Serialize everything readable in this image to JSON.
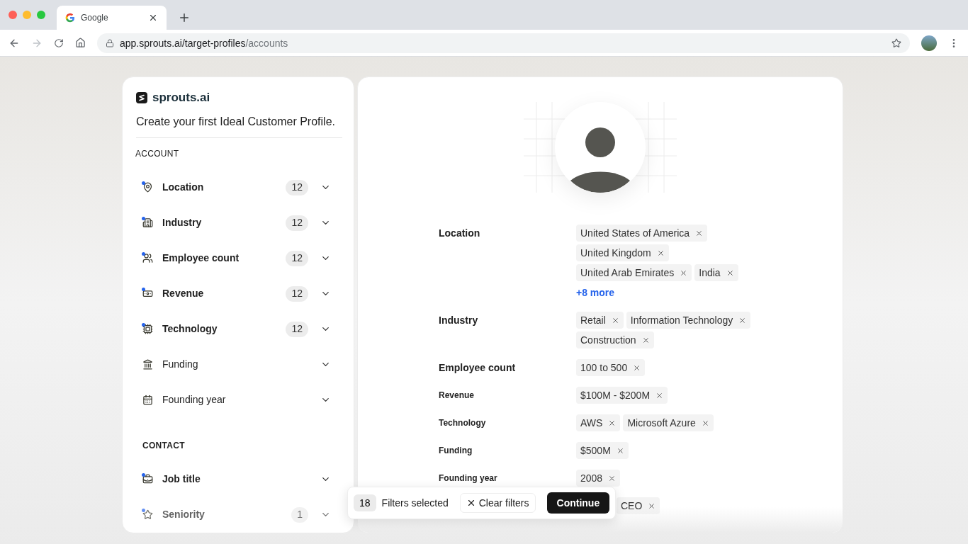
{
  "browser": {
    "tab_title": "Google",
    "url_host": "app.sprouts.ai/target-profiles",
    "url_path": "/accounts"
  },
  "sidebar": {
    "brand": "sprouts.ai",
    "heading": "Create your first Ideal Customer Profile.",
    "sections": [
      {
        "title": "ACCOUNT",
        "items": [
          {
            "label": "Location",
            "count": "12",
            "active": true
          },
          {
            "label": "Industry",
            "count": "12",
            "active": true
          },
          {
            "label": "Employee count",
            "count": "12",
            "active": true
          },
          {
            "label": "Revenue",
            "count": "12",
            "active": true
          },
          {
            "label": "Technology",
            "count": "12",
            "active": true
          },
          {
            "label": "Funding",
            "active": false
          },
          {
            "label": "Founding year",
            "active": false
          }
        ]
      },
      {
        "title": "CONTACT",
        "items": [
          {
            "label": "Job title",
            "active": true
          },
          {
            "label": "Seniority",
            "count": "1",
            "active": true
          }
        ]
      }
    ]
  },
  "filters": [
    {
      "label": "Location",
      "kind": "major",
      "chips": [
        "United States of America",
        "United Kingdom",
        "United Arab Emirates",
        "India"
      ],
      "more": "+8 more"
    },
    {
      "label": "Industry",
      "kind": "major",
      "chips": [
        "Retail",
        "Information Technology",
        "Construction"
      ]
    },
    {
      "label": "Employee count",
      "kind": "major",
      "chips": [
        "100 to 500"
      ]
    },
    {
      "label": "Revenue",
      "kind": "minor",
      "chips": [
        "$100M - $200M"
      ]
    },
    {
      "label": "Technology",
      "kind": "minor",
      "chips": [
        "AWS",
        "Microsoft Azure"
      ]
    },
    {
      "label": "Funding",
      "kind": "minor",
      "chips": [
        "$500M"
      ]
    },
    {
      "label": "Founding year",
      "kind": "minor",
      "chips": [
        "2008"
      ]
    },
    {
      "kind": "minor",
      "chips": [
        "CEO"
      ]
    }
  ],
  "footer": {
    "count": "18",
    "text": "Filters selected",
    "clear": "Clear filters",
    "continue": "Continue"
  }
}
